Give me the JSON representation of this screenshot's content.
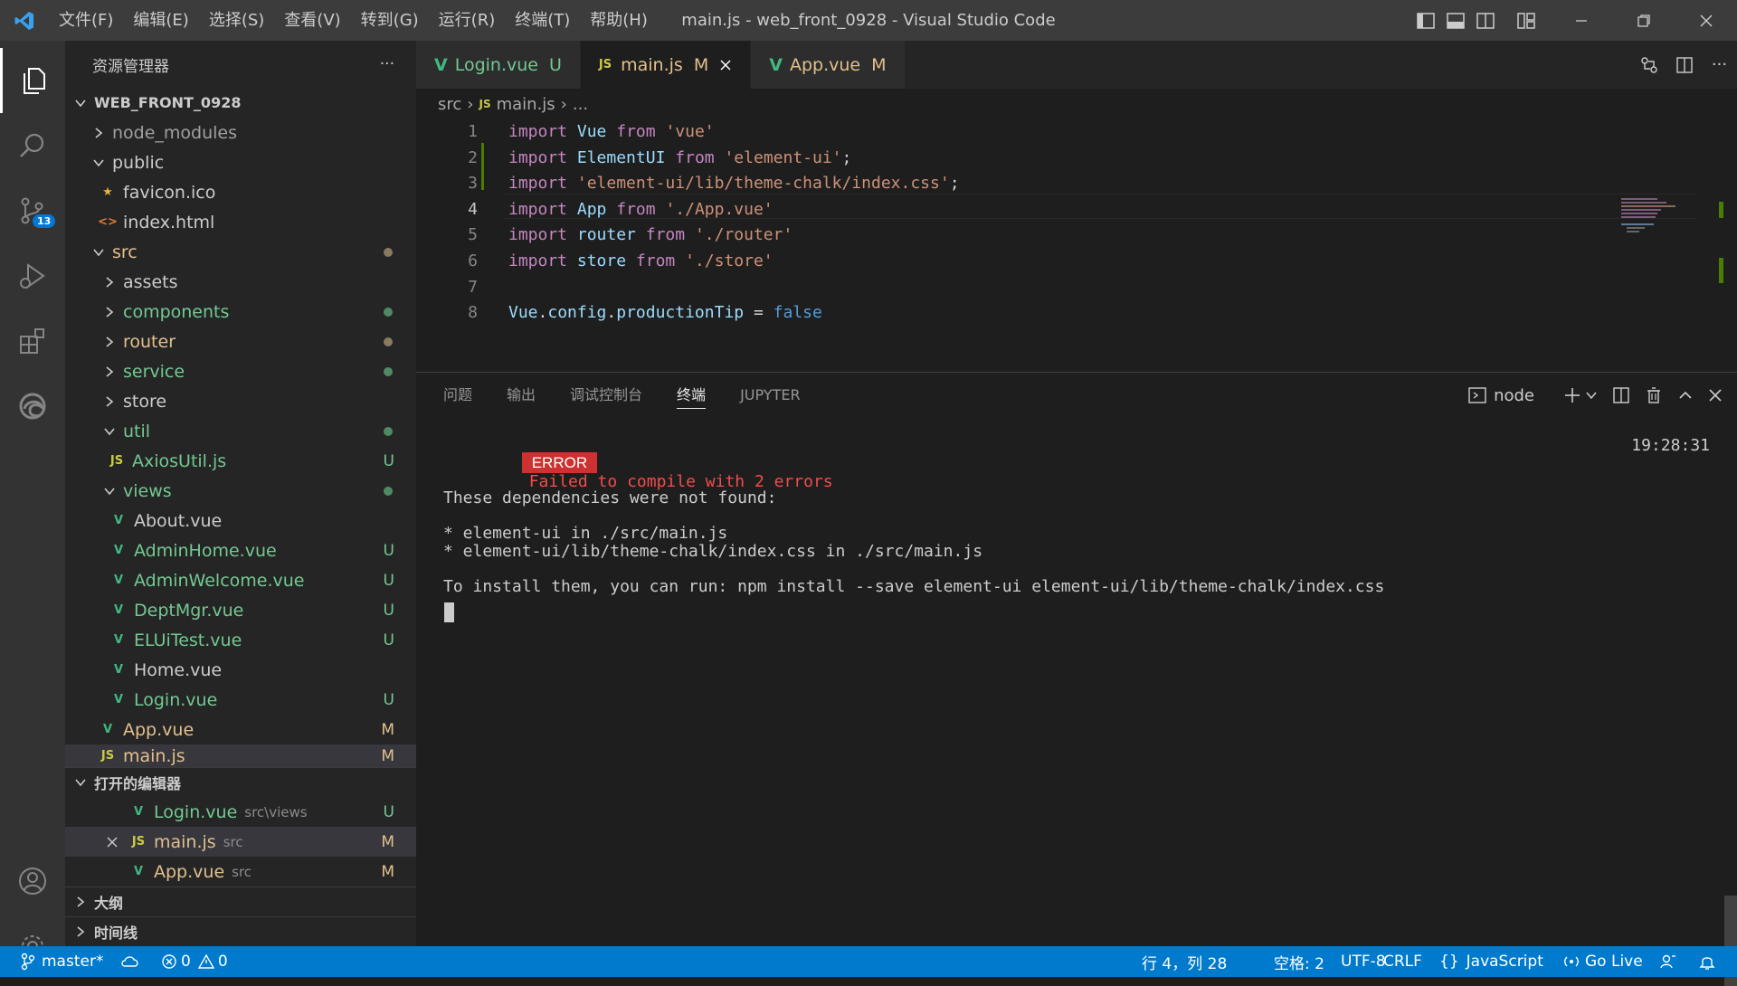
{
  "titlebar": {
    "title": "main.js - web_front_0928 - Visual Studio Code",
    "menu": [
      "文件(F)",
      "编辑(E)",
      "选择(S)",
      "查看(V)",
      "转到(G)",
      "运行(R)",
      "终端(T)",
      "帮助(H)"
    ]
  },
  "activity": {
    "scm_badge": "13"
  },
  "sidebar": {
    "title": "资源管理器",
    "more": "···",
    "project": "WEB_FRONT_0928",
    "tree": [
      {
        "label": "node_modules",
        "status": ""
      },
      {
        "label": "public",
        "status": ""
      },
      {
        "label": "favicon.ico",
        "status": ""
      },
      {
        "label": "index.html",
        "status": ""
      },
      {
        "label": "src",
        "status": ""
      },
      {
        "label": "assets",
        "status": ""
      },
      {
        "label": "components",
        "status": ""
      },
      {
        "label": "router",
        "status": ""
      },
      {
        "label": "service",
        "status": ""
      },
      {
        "label": "store",
        "status": ""
      },
      {
        "label": "util",
        "status": ""
      },
      {
        "label": "AxiosUtil.js",
        "status": "U"
      },
      {
        "label": "views",
        "status": ""
      },
      {
        "label": "About.vue",
        "status": ""
      },
      {
        "label": "AdminHome.vue",
        "status": "U"
      },
      {
        "label": "AdminWelcome.vue",
        "status": "U"
      },
      {
        "label": "DeptMgr.vue",
        "status": "U"
      },
      {
        "label": "ELUiTest.vue",
        "status": "U"
      },
      {
        "label": "Home.vue",
        "status": ""
      },
      {
        "label": "Login.vue",
        "status": "U"
      },
      {
        "label": "App.vue",
        "status": "M"
      },
      {
        "label": "main.js",
        "status": "M"
      }
    ],
    "open_editors_title": "打开的编辑器",
    "open_editors": [
      {
        "label": "Login.vue",
        "path": "src\\views",
        "status": "U"
      },
      {
        "label": "main.js",
        "path": "src",
        "status": "M"
      },
      {
        "label": "App.vue",
        "path": "src",
        "status": "M"
      }
    ],
    "outline_title": "大纲",
    "timeline_title": "时间线"
  },
  "tabs": [
    {
      "label": "Login.vue",
      "status": "U"
    },
    {
      "label": "main.js",
      "status": "M"
    },
    {
      "label": "App.vue",
      "status": "M"
    }
  ],
  "breadcrumb": {
    "folder": "src",
    "file": "main.js",
    "rest": "..."
  },
  "code": {
    "line_numbers": [
      "1",
      "2",
      "3",
      "4",
      "5",
      "6",
      "7",
      "8"
    ],
    "l1": {
      "k1": "import",
      "v": "Vue",
      "k2": "from",
      "s": "'vue'"
    },
    "l2": {
      "k1": "import",
      "v": "ElementUI",
      "k2": "from",
      "s": "'element-ui'",
      "p": ";"
    },
    "l3": {
      "k1": "import",
      "s": "'element-ui/lib/theme-chalk/index.css'",
      "p": ";"
    },
    "l4": {
      "k1": "import",
      "v": "App",
      "k2": "from",
      "s": "'./App.vue'"
    },
    "l5": {
      "k1": "import",
      "v": "router",
      "k2": "from",
      "s": "'./router'"
    },
    "l6": {
      "k1": "import",
      "v": "store",
      "k2": "from",
      "s": "'./store'"
    },
    "l8": {
      "v1": "Vue",
      "v2": "config",
      "v3": "productionTip",
      "op": " = ",
      "b": "false"
    }
  },
  "panel": {
    "tabs": [
      "问题",
      "输出",
      "调试控制台",
      "终端",
      "JUPYTER"
    ],
    "terminal_name": "node",
    "error_badge": "ERROR",
    "error_text": "Failed to compile with 2 errors",
    "time": "19:28:31",
    "lines": [
      "These dependencies were not found:",
      "* element-ui in ./src/main.js",
      "* element-ui/lib/theme-chalk/index.css in ./src/main.js",
      "To install them, you can run: npm install --save element-ui element-ui/lib/theme-chalk/index.css"
    ]
  },
  "statusbar": {
    "branch": "master*",
    "errors": "0",
    "warnings": "0",
    "position": "行 4，列 28",
    "spaces": "空格: 2",
    "encoding": "UTF-8",
    "eol": "CRLF",
    "language": "JavaScript",
    "golive": "Go Live",
    "language_icon": "{}"
  },
  "colors": {
    "statusbar": "#007acc",
    "vue": "#41b883",
    "modified": "#e2c08d",
    "untracked": "#73c991",
    "error": "#cd3131"
  }
}
